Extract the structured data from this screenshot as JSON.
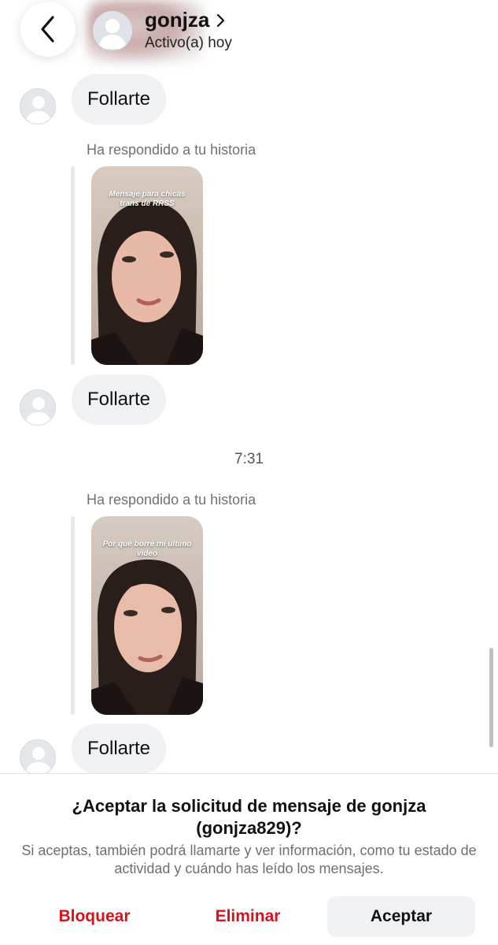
{
  "header": {
    "username": "gonjza",
    "status": "Activo(a) hoy"
  },
  "messages": [
    {
      "type": "text",
      "text": "Follarte"
    },
    {
      "type": "story_reply",
      "label": "Ha respondido a tu historia",
      "story_caption": "Mensaje para chicas trans de RRSS"
    },
    {
      "type": "text",
      "text": "Follarte"
    },
    {
      "type": "time",
      "text": "7:31"
    },
    {
      "type": "story_reply",
      "label": "Ha respondido a tu historia",
      "story_caption": "Por que borré mi ultimo video"
    },
    {
      "type": "text",
      "text": "Follarte"
    }
  ],
  "request_panel": {
    "title": "¿Aceptar la solicitud de mensaje de gonjza (gonjza829)?",
    "description": "Si aceptas, también podrá llamarte y ver información, como tu estado de actividad y cuándo has leído los mensajes.",
    "block_label": "Bloquear",
    "delete_label": "Eliminar",
    "accept_label": "Aceptar"
  },
  "colors": {
    "danger": "#d4141f",
    "bubble": "#eff1f5",
    "muted_text": "#6e7178"
  },
  "icons": {
    "back": "chevron-left-icon",
    "profile_link": "chevron-right-icon",
    "avatar": "default-avatar-icon"
  }
}
